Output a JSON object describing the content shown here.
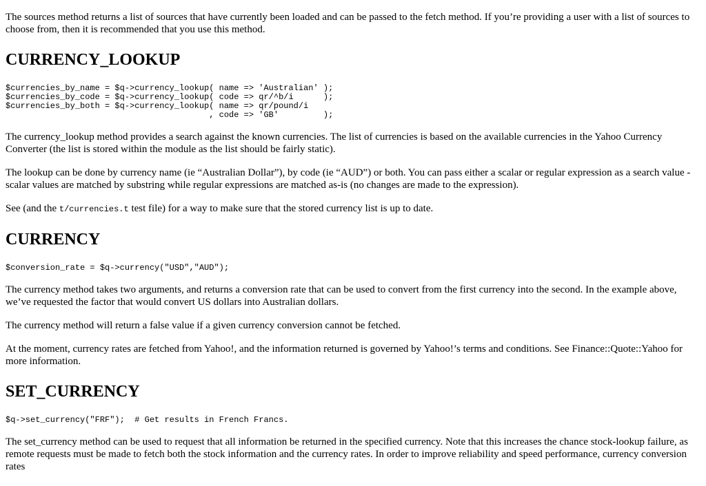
{
  "intro": {
    "text": "The sources method returns a list of sources that have currently been loaded and can be passed to the fetch method. If you’re providing a user with a list of sources to choose from, then it is recommended that you use this method."
  },
  "currency_lookup": {
    "heading": "CURRENCY_LOOKUP",
    "code": "$currencies_by_name = $q->currency_lookup( name => 'Australian' );\n$currencies_by_code = $q->currency_lookup( code => qr/^b/i      );\n$currencies_by_both = $q->currency_lookup( name => qr/pound/i\n                                         , code => 'GB'         );",
    "para1": "The currency_lookup method provides a search against the known currencies. The list of currencies is based on the available currencies in the Yahoo Currency Converter (the list is stored within the module as the list should be fairly static).",
    "para2": "The lookup can be done by currency name (ie “Australian Dollar”), by code (ie “AUD”) or both. You can pass either a scalar or regular expression as a search value - scalar values are matched by substring while regular expressions are matched as-is (no changes are made to the expression).",
    "para3_before": "See (and the ",
    "para3_code": "t/currencies.t",
    "para3_after": " test file) for a way to make sure that the stored currency list is up to date."
  },
  "currency": {
    "heading": "CURRENCY",
    "code": "$conversion_rate = $q->currency(\"USD\",\"AUD\");",
    "para1": "The currency method takes two arguments, and returns a conversion rate that can be used to convert from the first currency into the second. In the example above, we’ve requested the factor that would convert US dollars into Australian dollars.",
    "para2": "The currency method will return a false value if a given currency conversion cannot be fetched.",
    "para3": "At the moment, currency rates are fetched from Yahoo!, and the information returned is governed by Yahoo!’s terms and conditions. See Finance::Quote::Yahoo for more information."
  },
  "set_currency": {
    "heading": "SET_CURRENCY",
    "code": "$q->set_currency(\"FRF\");  # Get results in French Francs.",
    "para1": "The set_currency method can be used to request that all information be returned in the specified currency. Note that this increases the chance stock-lookup failure, as remote requests must be made to fetch both the stock information and the currency rates. In order to improve reliability and speed performance, currency conversion rates"
  }
}
